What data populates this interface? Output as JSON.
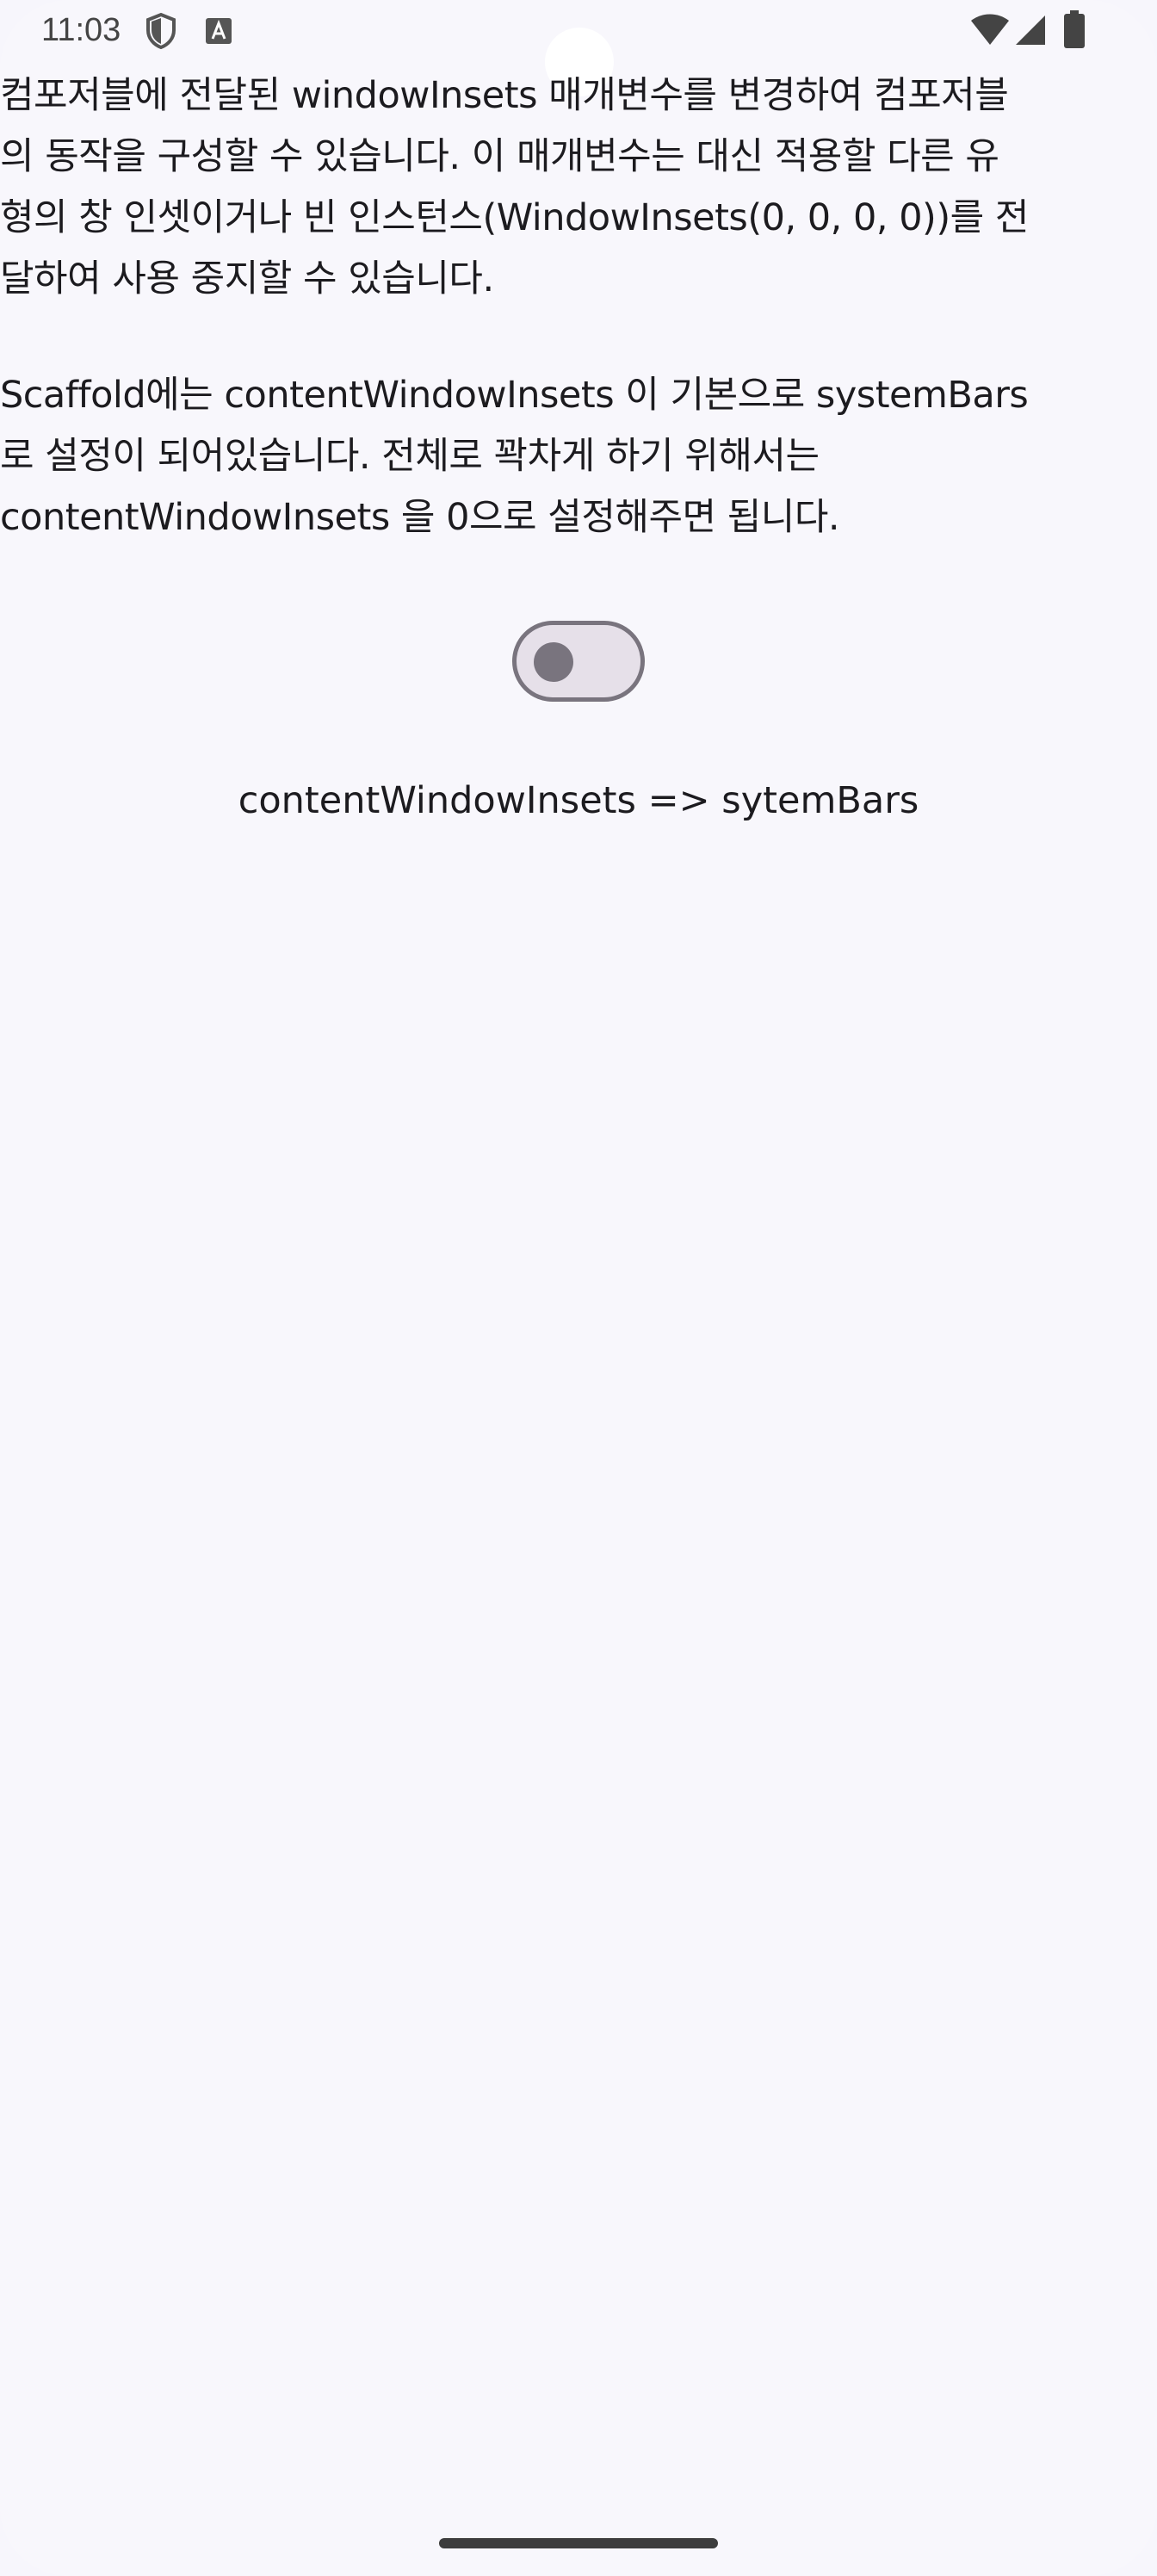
{
  "status_bar": {
    "time": "11:03",
    "icons": [
      "shield-icon",
      "keyboard-a-icon",
      "wifi-icon",
      "signal-icon",
      "battery-icon"
    ]
  },
  "main": {
    "paragraph_1": "컴포저블에 전달된 windowInsets 매개변수를 변경하여 컴포저블\n의 동작을 구성할 수 있습니다. 이 매개변수는 대신 적용할 다른 유\n형의 창 인셋이거나 빈 인스턴스(WindowInsets(0, 0, 0, 0))를 전\n달하여 사용 중지할 수 있습니다.",
    "paragraph_2": "Scaffold에는 contentWindowInsets 이 기본으로 systemBars\n로 설정이 되어있습니다. 전체로 꽉차게 하기 위해서는\ncontentWindowInsets 을 0으로 설정해주면 됩니다.",
    "switch": {
      "checked": false
    },
    "switch_label": "contentWindowInsets => sytemBars"
  },
  "colors": {
    "background": "#f8f7fc",
    "text": "#1c1b1f",
    "switch_outline": "#79747e",
    "switch_track": "#e6e0e9"
  }
}
